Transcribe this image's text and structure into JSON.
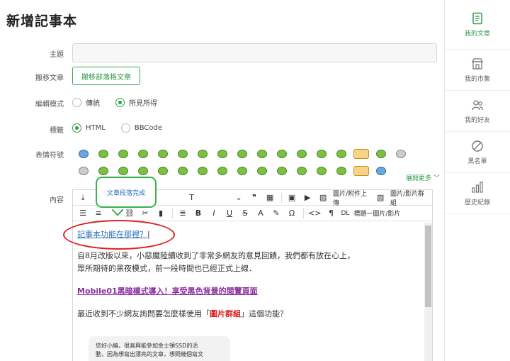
{
  "page": {
    "title": "新增記事本"
  },
  "form": {
    "subject_label": "主題",
    "move_label": "搬移文章",
    "move_button": "搬移部落格文章",
    "edit_mode_label": "編輯模式",
    "edit_mode_options": [
      "傳統",
      "所見所得"
    ],
    "edit_mode_selected": "所見所得",
    "tag_label": "標籤",
    "tag_options": [
      "HTML",
      "BBCode"
    ],
    "tag_selected": "HTML",
    "emoticon_label": "表情符號",
    "expand_more": "展開更多 ﹀",
    "content_label": "內容"
  },
  "toolbar": {
    "row1": {
      "download_icon": "download-icon",
      "quote_icon": "quote-icon",
      "table_icon": "table-icon",
      "image_upload": "圖片/附件上傳",
      "image_group": "圖片/影片群組"
    },
    "row2": {
      "bold": "B",
      "italic": "I",
      "underline": "U",
      "strike": "S",
      "omega": "Ω",
      "code": "<>",
      "pilcrow": "¶",
      "dl": "DL",
      "caption": "標題一圖片/影片"
    }
  },
  "tooltip": {
    "text": "文章段落完成"
  },
  "content": {
    "heading_link": "記事本功能在那裡？",
    "para1_line1": "自8月改版以來，小惡魔陸續收到了非常多網友的意見回饋，我們都有放在心上，",
    "para1_line2": "眾所期待的黑夜模式，前一段時間也已經正式上線．",
    "mobile_link": "Mobile01黑暗模式導入！享受黑色背景的閱覽頁面",
    "para2_prefix": "最近收到不少網友詢問要怎麼樣使用「",
    "para2_highlight": "圖片群組",
    "para2_suffix": "」這個功能？",
    "comment_line1": "您好小編，很高興能參加金士頓SSD的活",
    "comment_line2": "動，因為想寫出漂亮的文章，想問幾個寫文"
  },
  "sidebar": {
    "items": [
      {
        "label": "我的文章",
        "icon": "document-icon",
        "active": true
      },
      {
        "label": "我的市集",
        "icon": "store-icon",
        "active": false
      },
      {
        "label": "我的好友",
        "icon": "friends-icon",
        "active": false
      },
      {
        "label": "黑名單",
        "icon": "block-icon",
        "active": false
      },
      {
        "label": "歷史紀錄",
        "icon": "chart-icon",
        "active": false
      }
    ]
  },
  "colors": {
    "accent": "#2e9a48",
    "annotation_red": "#e02020",
    "annotation_green": "#38b34a"
  }
}
